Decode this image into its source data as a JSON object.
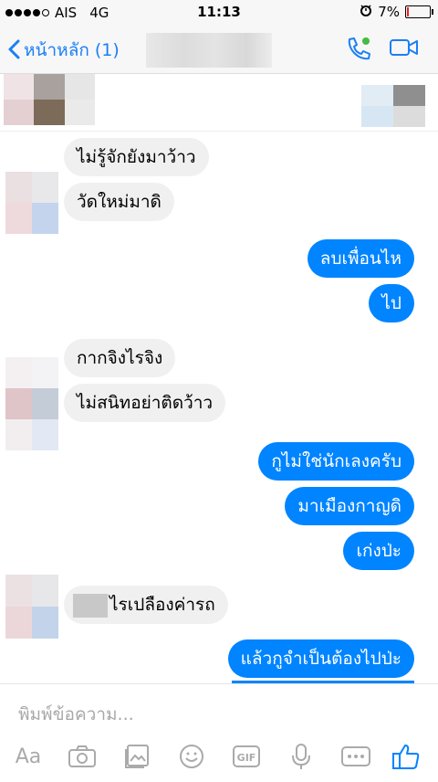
{
  "status": {
    "carrier": "AIS",
    "network": "4G",
    "time": "11:13",
    "battery": "7%",
    "battery_level": 0.07
  },
  "nav": {
    "back_label": "หน้าหลัก (1)"
  },
  "colors": {
    "accent": "#0084ff",
    "nav_blue": "#1a7ff5",
    "incoming_bg": "#f1f0f0",
    "online": "#44bb44"
  },
  "messages": [
    {
      "dir": "in",
      "text": "ไม่รู้จักยังมาว้าว"
    },
    {
      "dir": "in",
      "text": "วัดใหม่มาดิ"
    },
    {
      "dir": "out",
      "text": "ลบเพื่อนไห"
    },
    {
      "dir": "out",
      "text": "ไป"
    },
    {
      "dir": "in",
      "text": "กากจิงไรจิง"
    },
    {
      "dir": "in",
      "text": "ไม่สนิทอย่าติดว้าว"
    },
    {
      "dir": "out",
      "text": "กูไม่ใช่นักเลงครับ"
    },
    {
      "dir": "out",
      "text": "มาเมืองกาญดิ"
    },
    {
      "dir": "out",
      "text": "เก่งป่ะ"
    },
    {
      "dir": "in",
      "text": "ไรเปลืองค่ารถ"
    },
    {
      "dir": "out",
      "text": "แล้วกูจำเป็นต้องไปป่ะ"
    }
  ],
  "composer": {
    "placeholder": "พิมพ์ข้อความ...",
    "text_tool": "Aa",
    "gif_tool": "GIF",
    "tools": [
      "text-icon",
      "camera-icon",
      "gallery-icon",
      "emoji-icon",
      "gif-icon",
      "microphone-icon",
      "more-icon",
      "like-icon"
    ]
  }
}
